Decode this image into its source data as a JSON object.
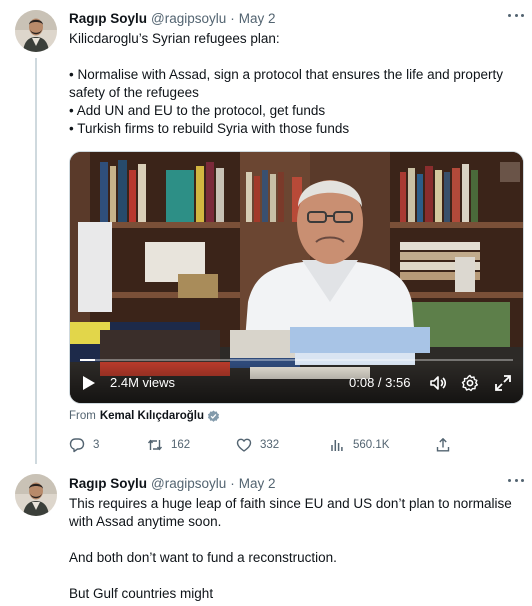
{
  "tweets": [
    {
      "author": {
        "name": "Ragıp Soylu",
        "handle": "@ragipsoylu",
        "avatar_icon": "person-avatar"
      },
      "separator": "·",
      "date": "May 2",
      "paragraphs": [
        "Kilicdaroglu’s Syrian refugees plan:",
        "• Normalise with Assad, sign a protocol that ensures the life and property safety of the refugees\n• Add UN and EU to the protocol, get funds\n• Turkish firms to rebuild Syria with those funds"
      ],
      "video": {
        "views": "2.4M views",
        "time": "0:08 / 3:56",
        "progress": 0.035
      },
      "attribution": {
        "prefix": "From",
        "name": "Kemal Kılıçdaroğlu"
      },
      "actions": {
        "replies": "3",
        "retweets": "162",
        "likes": "332",
        "views": "560.1K"
      }
    },
    {
      "author": {
        "name": "Ragıp Soylu",
        "handle": "@ragipsoylu",
        "avatar_icon": "person-avatar"
      },
      "separator": "·",
      "date": "May 2",
      "paragraphs": [
        "This requires a huge leap of faith since EU and US don’t plan to normalise with Assad anytime soon.",
        "And both don’t want to fund a reconstruction.",
        "But Gulf countries might"
      ]
    }
  ],
  "colors": {
    "text": "#0f1419",
    "secondary": "#536471",
    "accent": "#1d9bf0",
    "line": "#cfd9de"
  }
}
